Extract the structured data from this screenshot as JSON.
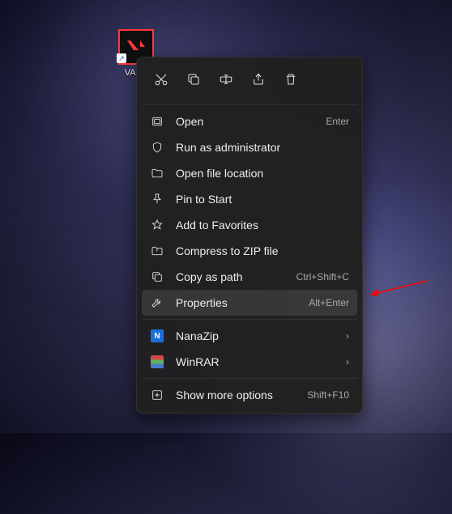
{
  "desktop": {
    "icon_label": "VALO"
  },
  "toolbar": {
    "cut": "Cut",
    "copy": "Copy",
    "rename": "Rename",
    "share": "Share",
    "delete": "Delete"
  },
  "menu": {
    "open": {
      "label": "Open",
      "shortcut": "Enter"
    },
    "run_admin": {
      "label": "Run as administrator"
    },
    "open_location": {
      "label": "Open file location"
    },
    "pin_start": {
      "label": "Pin to Start"
    },
    "add_fav": {
      "label": "Add to Favorites"
    },
    "compress_zip": {
      "label": "Compress to ZIP file"
    },
    "copy_path": {
      "label": "Copy as path",
      "shortcut": "Ctrl+Shift+C"
    },
    "properties": {
      "label": "Properties",
      "shortcut": "Alt+Enter"
    },
    "nanazip": {
      "label": "NanaZip"
    },
    "winrar": {
      "label": "WinRAR"
    },
    "show_more": {
      "label": "Show more options",
      "shortcut": "Shift+F10"
    }
  },
  "annotation": {
    "color": "#ff0000"
  }
}
